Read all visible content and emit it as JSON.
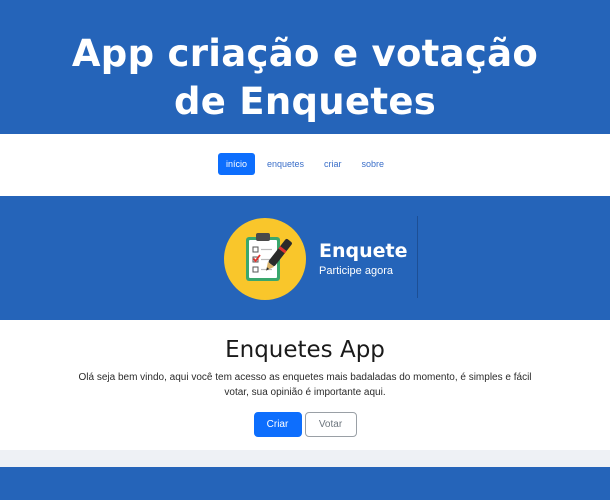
{
  "banner": {
    "title_line1": "App criação e votação",
    "title_line2": "de Enquetes"
  },
  "nav": {
    "items": [
      {
        "label": "início",
        "active": true
      },
      {
        "label": "enquetes",
        "active": false
      },
      {
        "label": "criar",
        "active": false
      },
      {
        "label": "sobre",
        "active": false
      }
    ]
  },
  "logo": {
    "icon": "clipboard-checklist-pen-icon",
    "title": "Enquete",
    "subtitle": "Participe agora"
  },
  "main": {
    "title": "Enquetes App",
    "description": "Olá seja bem vindo, aqui você tem acesso as enquetes mais badaladas do momento, é simples e fácil votar, sua opinião é importante aqui.",
    "buttons": {
      "create_label": "Criar",
      "vote_label": "Votar"
    }
  },
  "colors": {
    "brand_blue": "#2564b9",
    "primary": "#0d6efd",
    "logo_yellow": "#f9c62b"
  }
}
